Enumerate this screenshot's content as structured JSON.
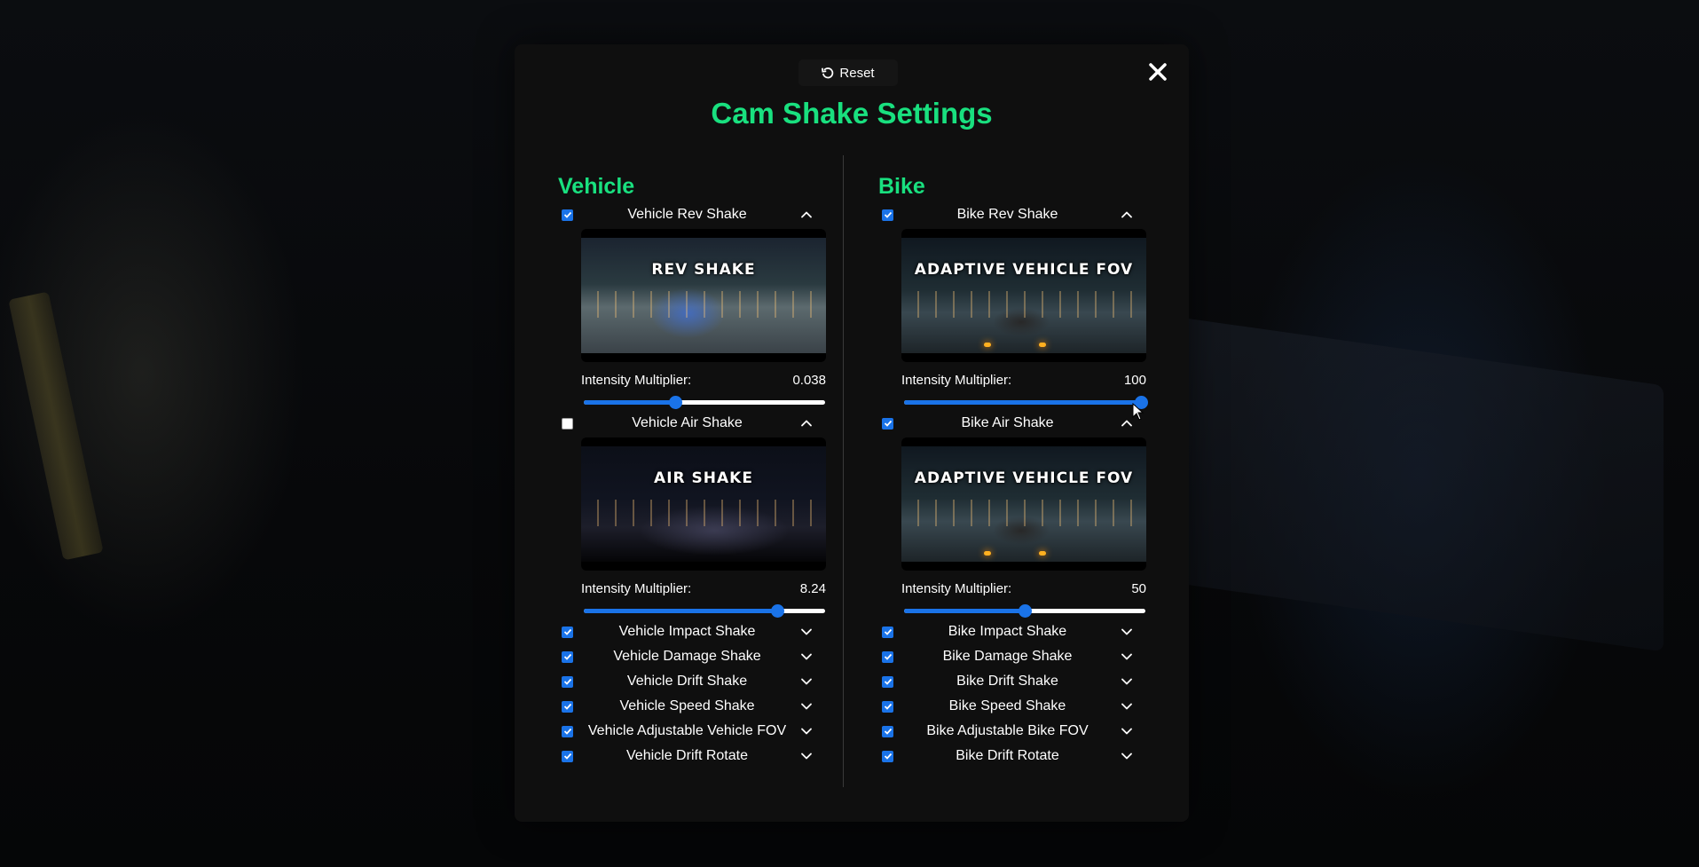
{
  "reset_label": "Reset",
  "title": "Cam Shake Settings",
  "colors": {
    "accent": "#19e07f",
    "blue": "#1a73e8",
    "panel": "#0f0f0f"
  },
  "vehicle": {
    "heading": "Vehicle",
    "sections": [
      {
        "label": "Vehicle Rev Shake",
        "checked": true,
        "expanded": true,
        "preview_text": "REV SHAKE",
        "intensity_label": "Intensity Multiplier:",
        "intensity_value": "0.038",
        "slider_fraction": 0.38
      },
      {
        "label": "Vehicle Air Shake",
        "checked": false,
        "expanded": true,
        "preview_text": "AIR SHAKE",
        "intensity_label": "Intensity Multiplier:",
        "intensity_value": "8.24",
        "slider_fraction": 0.8
      }
    ],
    "items": [
      "Vehicle Impact Shake",
      "Vehicle Damage Shake",
      "Vehicle Drift Shake",
      "Vehicle Speed Shake",
      "Vehicle Adjustable Vehicle FOV",
      "Vehicle Drift Rotate"
    ]
  },
  "bike": {
    "heading": "Bike",
    "sections": [
      {
        "label": "Bike Rev Shake",
        "checked": true,
        "expanded": true,
        "preview_text": "ADAPTIVE VEHICLE FOV",
        "intensity_label": "Intensity Multiplier:",
        "intensity_value": "100",
        "slider_fraction": 1.0
      },
      {
        "label": "Bike Air Shake",
        "checked": true,
        "expanded": true,
        "preview_text": "ADAPTIVE VEHICLE FOV",
        "intensity_label": "Intensity Multiplier:",
        "intensity_value": "50",
        "slider_fraction": 0.5
      }
    ],
    "items": [
      "Bike Impact Shake",
      "Bike Damage Shake",
      "Bike Drift Shake",
      "Bike Speed Shake",
      "Bike Adjustable Bike FOV",
      "Bike Drift Rotate"
    ]
  }
}
